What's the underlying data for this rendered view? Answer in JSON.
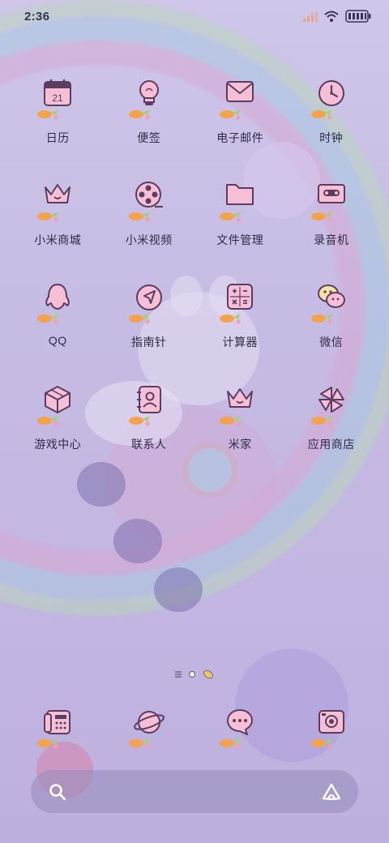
{
  "status_bar": {
    "time": "2:36",
    "icons": [
      "signal-icon",
      "wifi-icon",
      "battery-icon"
    ]
  },
  "apps": [
    {
      "label": "日历",
      "icon": "calendar-icon",
      "icon_text": "21"
    },
    {
      "label": "便签",
      "icon": "lightbulb-icon"
    },
    {
      "label": "电子邮件",
      "icon": "mail-icon"
    },
    {
      "label": "时钟",
      "icon": "clock-icon"
    },
    {
      "label": "小米商城",
      "icon": "crown-icon"
    },
    {
      "label": "小米视频",
      "icon": "film-reel-icon"
    },
    {
      "label": "文件管理",
      "icon": "folder-icon"
    },
    {
      "label": "录音机",
      "icon": "cassette-icon"
    },
    {
      "label": "QQ",
      "icon": "penguin-icon"
    },
    {
      "label": "指南针",
      "icon": "compass-icon"
    },
    {
      "label": "计算器",
      "icon": "calculator-icon"
    },
    {
      "label": "微信",
      "icon": "chat-bubbles-icon"
    },
    {
      "label": "游戏中心",
      "icon": "cube-icon"
    },
    {
      "label": "联系人",
      "icon": "contacts-book-icon"
    },
    {
      "label": "米家",
      "icon": "home-crown-icon"
    },
    {
      "label": "应用商店",
      "icon": "store-pinwheel-icon"
    }
  ],
  "dock": [
    {
      "icon": "telephone-icon"
    },
    {
      "icon": "planet-icon"
    },
    {
      "icon": "message-bubble-icon"
    },
    {
      "icon": "camera-icon"
    }
  ],
  "search_bar": {
    "left_icon": "search-icon",
    "right_icon": "assistant-icon"
  },
  "colors": {
    "icon_pink": "#f6bfd6",
    "icon_stroke": "#5a3e62",
    "carrot_orange": "#f2a34c",
    "leaf_green": "#a5cf72",
    "text": "#2f2a45"
  }
}
